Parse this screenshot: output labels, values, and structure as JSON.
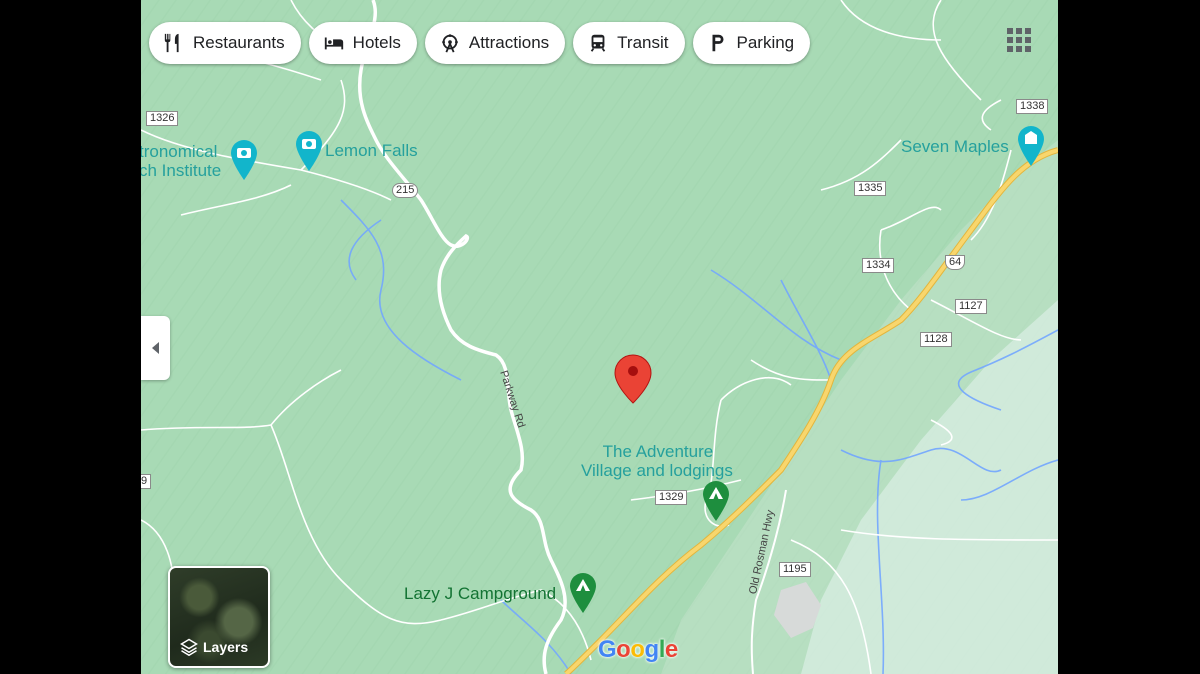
{
  "filters": [
    {
      "label": "Restaurants",
      "icon": "restaurant-icon"
    },
    {
      "label": "Hotels",
      "icon": "hotel-icon"
    },
    {
      "label": "Attractions",
      "icon": "attractions-icon"
    },
    {
      "label": "Transit",
      "icon": "transit-icon"
    },
    {
      "label": "Parking",
      "icon": "parking-icon"
    }
  ],
  "places": {
    "astronomical": "tronomical",
    "astronomical_line2": "ch Institute",
    "lemon_falls": "Lemon Falls",
    "seven_maples": "Seven Maples",
    "adventure_village_line1": "The Adventure",
    "adventure_village_line2": "Village and lodgings",
    "lazy_j": "Lazy J Campground"
  },
  "roads": {
    "r1326": "1326",
    "r215": "215",
    "r1338": "1338",
    "r1335": "1335",
    "r1334": "1334",
    "r64": "64",
    "r1127": "1127",
    "r1128": "1128",
    "r1329": "1329",
    "r1195": "1195",
    "parkway": "Parkway Rd",
    "old_rosman": "Old Rosman Hwy",
    "edge_9": "9"
  },
  "layers_label": "Layers",
  "google_logo": {
    "letters": [
      "G",
      "o",
      "o",
      "g",
      "l",
      "e"
    ],
    "colors": [
      "#4285f4",
      "#ea4335",
      "#fbbc05",
      "#4285f4",
      "#34a853",
      "#ea4335"
    ]
  },
  "colors": {
    "terrain": "#a8dab5",
    "highway": "#f6d36a",
    "water": "#72a6ff",
    "pin": "#ea4335"
  }
}
